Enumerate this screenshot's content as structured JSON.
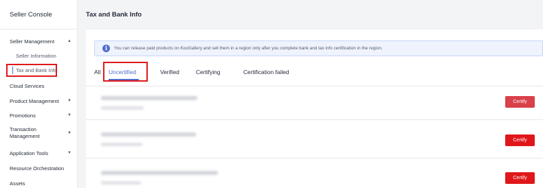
{
  "sidebar": {
    "title": "Seller Console",
    "items": {
      "seller_management": "Seller Management",
      "seller_information": "Seller Information",
      "tax_and_bank_info": "Tax and Bank Info",
      "cloud_services": "Cloud Services",
      "product_management": "Product Management",
      "promotions": "Promotions",
      "transaction_management": "Transaction Management",
      "application_tools": "Application Tools",
      "resource_orchestration": "Resource Orchestration",
      "assets": "Assets"
    },
    "caret_up": "▲",
    "caret_down": "▼"
  },
  "header": {
    "title": "Tax and Bank Info"
  },
  "notice": {
    "icon": "i",
    "text": "You can release paid products on KooGallery and sell them in a region only after you complete bank and tax info certification in the region."
  },
  "tabs": {
    "all": "All",
    "uncertified": "Uncertified",
    "verified": "Verified",
    "certifying": "Certifying",
    "certification_failed": "Certification failed"
  },
  "rows": {
    "certify_label": "Certify"
  },
  "colors": {
    "accent": "#526ecc",
    "danger": "#e0171a",
    "annotation": "#e0171a"
  }
}
